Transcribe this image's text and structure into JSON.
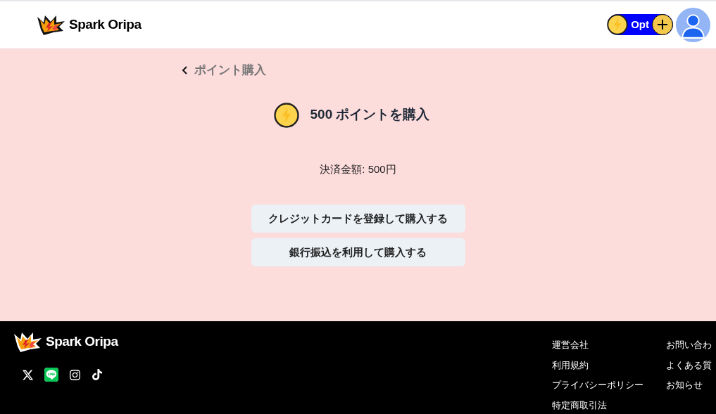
{
  "header": {
    "logo": "Spark Oripa",
    "points": "Opt"
  },
  "page": {
    "back_label": "ポイント購入",
    "title": "500 ポイントを購入",
    "amount": "決済金額: 500円",
    "buttons": [
      "クレジットカードを登録して購入する",
      "銀行振込を利用して購入する"
    ]
  },
  "footer": {
    "logo": "Spark Oripa",
    "link_columns": [
      [
        "運営会社",
        "利用規約",
        "プライバシーポリシー",
        "特定商取引法"
      ],
      [
        "お問い合わ",
        "よくある質",
        "お知らせ"
      ]
    ]
  }
}
